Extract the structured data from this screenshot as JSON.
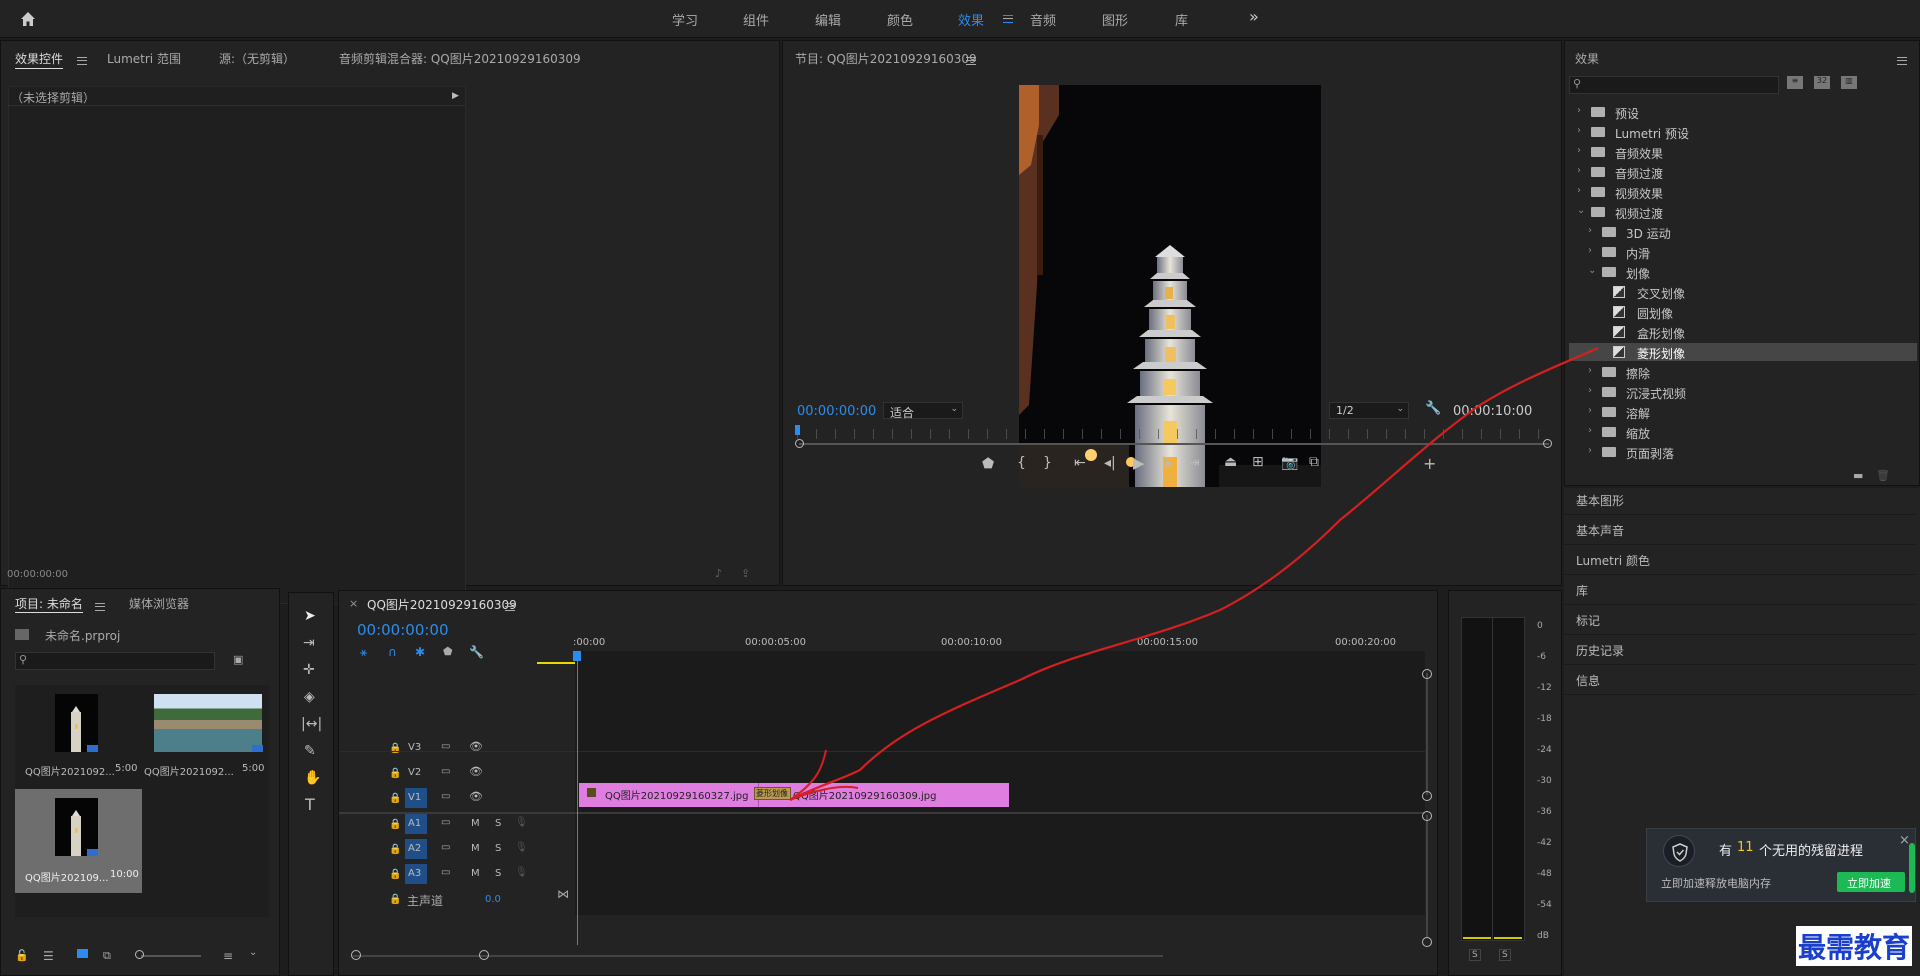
{
  "workspaces": [
    "学习",
    "组件",
    "编辑",
    "颜色",
    "效果",
    "音频",
    "图形",
    "库"
  ],
  "active_workspace_index": 4,
  "overflow": "»",
  "effect_controls": {
    "tabs": [
      "效果控件",
      "Lumetri 范围",
      "源:（无剪辑）",
      "音频剪辑混合器: QQ图片20210929160309"
    ],
    "no_clip": "（未选择剪辑）",
    "timecode": "00:00:00:00"
  },
  "program": {
    "title": "节目: QQ图片20210929160309",
    "timecode": "00:00:00:00",
    "fit": "适合",
    "quality": "1/2",
    "duration": "00:00:10:00"
  },
  "effects": {
    "title": "效果",
    "search_placeholder": "",
    "items": [
      {
        "label": "预设",
        "level": 0,
        "state": "collapsed",
        "icon": "preset-folder"
      },
      {
        "label": "Lumetri 预设",
        "level": 0,
        "state": "collapsed",
        "icon": "preset-folder"
      },
      {
        "label": "音频效果",
        "level": 0,
        "state": "collapsed",
        "icon": "folder"
      },
      {
        "label": "音频过渡",
        "level": 0,
        "state": "collapsed",
        "icon": "folder"
      },
      {
        "label": "视频效果",
        "level": 0,
        "state": "collapsed",
        "icon": "folder"
      },
      {
        "label": "视频过渡",
        "level": 0,
        "state": "expanded",
        "icon": "folder"
      },
      {
        "label": "3D 运动",
        "level": 1,
        "state": "collapsed",
        "icon": "folder"
      },
      {
        "label": "内滑",
        "level": 1,
        "state": "collapsed",
        "icon": "folder"
      },
      {
        "label": "划像",
        "level": 1,
        "state": "expanded",
        "icon": "folder"
      },
      {
        "label": "交叉划像",
        "level": 2,
        "state": "leaf",
        "icon": "transition"
      },
      {
        "label": "圆划像",
        "level": 2,
        "state": "leaf",
        "icon": "transition"
      },
      {
        "label": "盒形划像",
        "level": 2,
        "state": "leaf",
        "icon": "transition"
      },
      {
        "label": "菱形划像",
        "level": 2,
        "state": "leaf",
        "icon": "transition",
        "selected": true
      },
      {
        "label": "擦除",
        "level": 1,
        "state": "collapsed",
        "icon": "folder"
      },
      {
        "label": "沉浸式视频",
        "level": 1,
        "state": "collapsed",
        "icon": "folder"
      },
      {
        "label": "溶解",
        "level": 1,
        "state": "collapsed",
        "icon": "folder"
      },
      {
        "label": "缩放",
        "level": 1,
        "state": "collapsed",
        "icon": "folder"
      },
      {
        "label": "页面剥落",
        "level": 1,
        "state": "collapsed",
        "icon": "folder"
      }
    ]
  },
  "side_panels": [
    "基本图形",
    "基本声音",
    "Lumetri 颜色",
    "库",
    "标记",
    "历史记录",
    "信息"
  ],
  "project": {
    "tabs": [
      "项目: 未命名",
      "媒体浏览器"
    ],
    "file": "未命名.prproj",
    "items": [
      {
        "label": "QQ图片2021092...",
        "duration": "5:00"
      },
      {
        "label": "QQ图片2021092...",
        "duration": "5:00"
      },
      {
        "label": "QQ图片202109...",
        "duration": "10:00"
      }
    ]
  },
  "timeline": {
    "title": "QQ图片20210929160309",
    "timecode": "00:00:00:00",
    "ruler": [
      ":00:00",
      "00:00:05:00",
      "00:00:10:00",
      "00:00:15:00",
      "00:00:20:00"
    ],
    "tracks": [
      {
        "name": "V3",
        "type": "video"
      },
      {
        "name": "V2",
        "type": "video"
      },
      {
        "name": "V1",
        "type": "video",
        "active": true
      },
      {
        "name": "A1",
        "type": "audio",
        "active": true
      },
      {
        "name": "A2",
        "type": "audio",
        "active": true
      },
      {
        "name": "A3",
        "type": "audio",
        "active": true
      }
    ],
    "master": {
      "label": "主声道",
      "value": "0.0"
    },
    "clips": [
      {
        "label": "QQ图片20210929160327.jpg"
      },
      {
        "label": "QQ图片20210929160309.jpg"
      }
    ],
    "transition": "菱形划像",
    "track_m": "M",
    "track_s": "S"
  },
  "meter": {
    "scale": [
      "0",
      "-6",
      "-12",
      "-18",
      "-24",
      "-30",
      "-36",
      "-42",
      "-48",
      "-54",
      "dB"
    ],
    "solo": [
      "S",
      "S"
    ]
  },
  "notification": {
    "prefix": "有",
    "count": "11",
    "suffix": "个无用的残留进程",
    "sub": "立即加速释放电脑内存",
    "button": "立即加速"
  },
  "watermark": "最需教育",
  "colors": {
    "accent": "#2d8ceb",
    "clip": "#e07de0",
    "notify_button": "#1db954",
    "annotation": "#d42020"
  }
}
